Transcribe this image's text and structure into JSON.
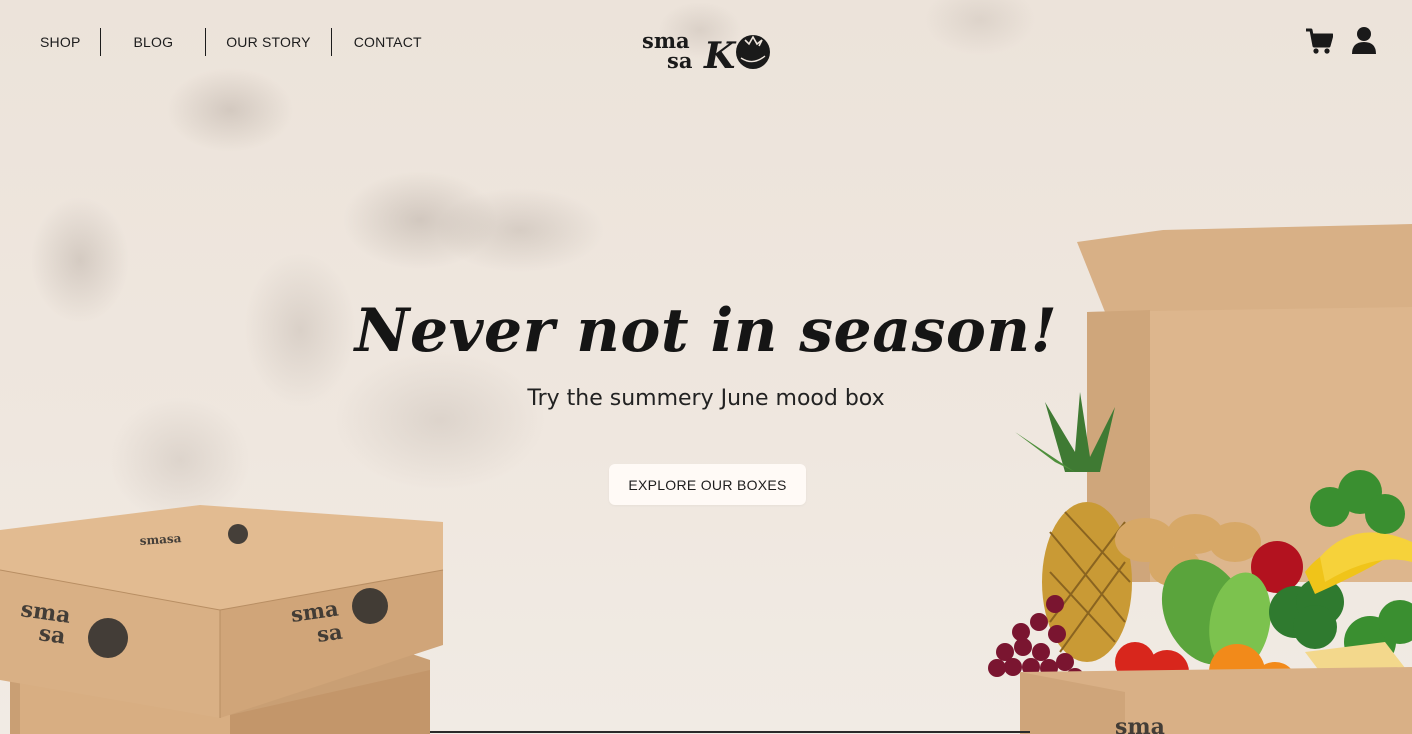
{
  "nav": {
    "items": [
      {
        "label": "SHOP"
      },
      {
        "label": "BLOG"
      },
      {
        "label": "OUR STORY"
      },
      {
        "label": "CONTACT"
      }
    ]
  },
  "logo": {
    "line1": "sma",
    "line2": "sa",
    "mark": "K"
  },
  "header_icons": {
    "cart": "cart-icon",
    "account": "user-icon"
  },
  "hero": {
    "headline": "Never not in season!",
    "subheading": "Try the summery June mood box",
    "cta_label": "EXPLORE OUR BOXES"
  },
  "colors": {
    "background": "#efe6dd",
    "text": "#1b1b1b",
    "cardboard": "#d7ad80",
    "button_bg": "#fffaf6"
  }
}
